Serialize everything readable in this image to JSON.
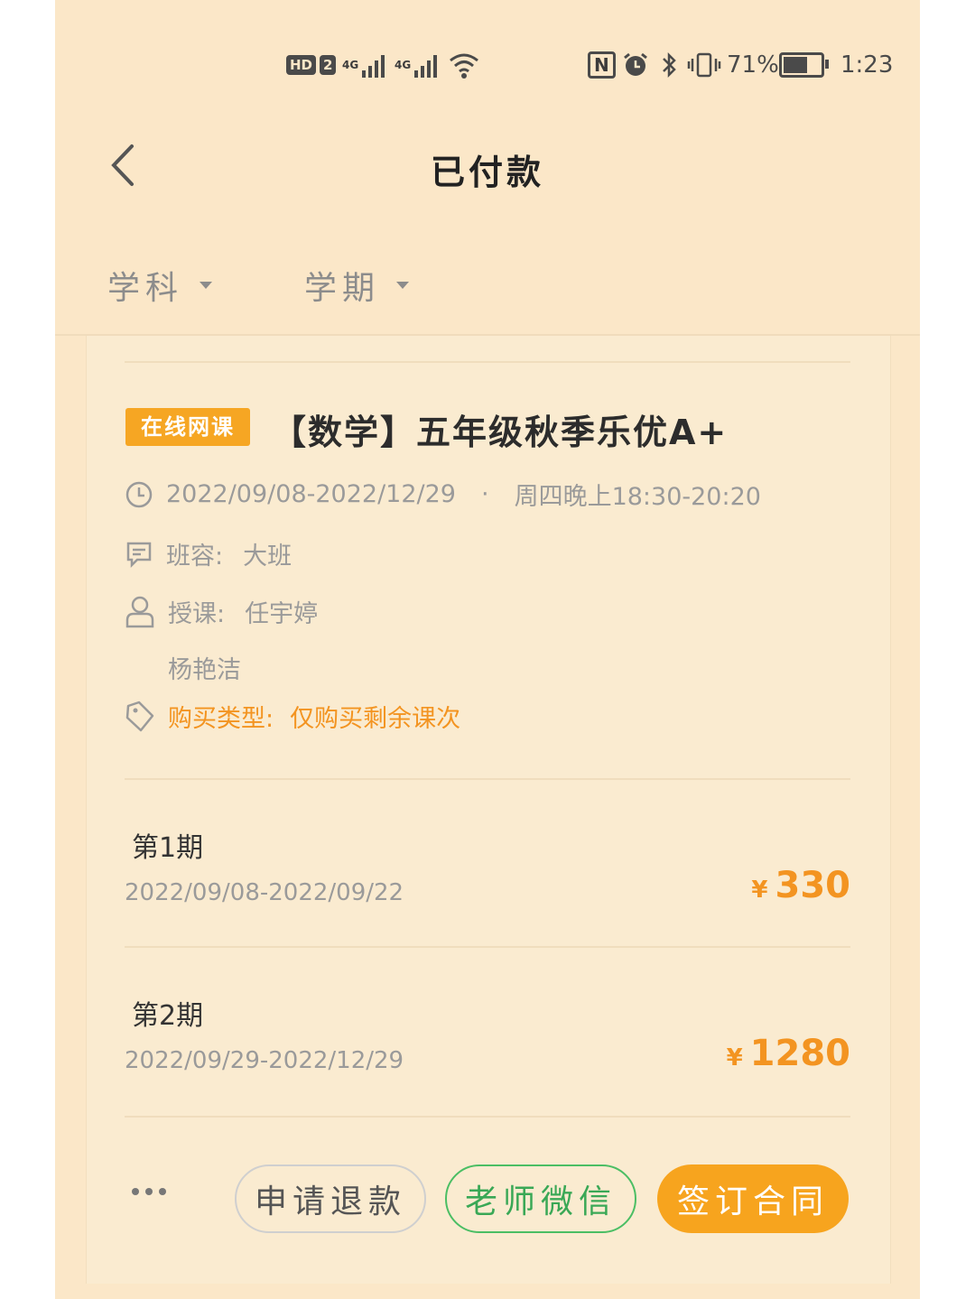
{
  "status_bar": {
    "hd": "HD",
    "sim": "2",
    "net1": "4G",
    "net2": "4G",
    "nfc": "N",
    "battery_pct": "71%",
    "battery_level": 0.71,
    "time": "1:23"
  },
  "header": {
    "title": "已付款"
  },
  "filters": [
    {
      "label": "学科"
    },
    {
      "label": "学期"
    }
  ],
  "course": {
    "badge": "在线网课",
    "title": "【数学】五年级秋季乐优A+",
    "date_range": "2022/09/08-2022/12/29",
    "separator": "·",
    "schedule": "周四晚上18:30-20:20",
    "class_size_label": "班容:",
    "class_size": "大班",
    "teacher_label": "授课:",
    "teacher_1": "任宇婷",
    "teacher_2": "杨艳洁",
    "purchase_type_label": "购买类型:",
    "purchase_type": "仅购买剩余课次"
  },
  "periods": [
    {
      "name": "第1期",
      "dates": "2022/09/08-2022/09/22",
      "currency": "¥",
      "price": "330"
    },
    {
      "name": "第2期",
      "dates": "2022/09/29-2022/12/29",
      "currency": "¥",
      "price": "1280"
    }
  ],
  "actions": {
    "refund": "申请退款",
    "teacher_wechat": "老师微信",
    "sign_contract": "签订合同"
  },
  "colors": {
    "background": "#fbe7c8",
    "accent_orange": "#f39421",
    "green": "#4bbe64"
  }
}
